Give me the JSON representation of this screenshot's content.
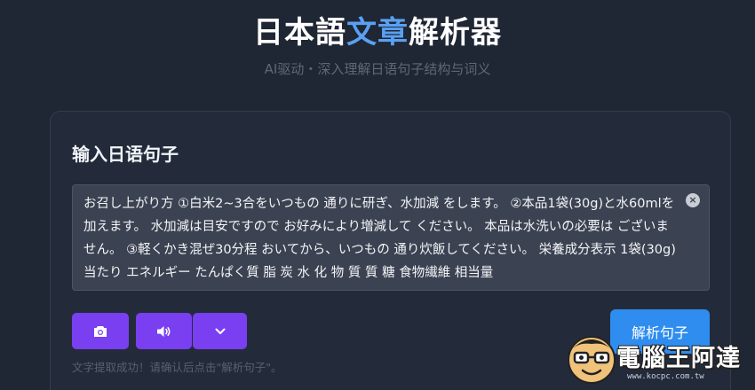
{
  "header": {
    "title_part1": "日本語",
    "title_accent": "文章",
    "title_part2": "解析器",
    "subtitle": "AI驱动・深入理解日语句子结构与词义"
  },
  "input_card": {
    "title": "输入日语句子",
    "text": "お召し上がり方 ①白米2~3合をいつもの 通りに研ぎ、水加減 をします。 ②本品1袋(30g)と水60mlを加えます。 水加減は目安ですので お好みにより増減して ください。 本品は水洗いの必要は ございません。 ③軽くかき混ぜ30分程 おいてから、いつもの 通り炊飯してください。 栄養成分表示 1袋(30g) 当たり エネルギー たんぱく質 脂 炭 水 化 物 質 質 糖 食物繊維 相当量",
    "clear_icon": "close-icon",
    "clear_symbol": "×"
  },
  "toolbar": {
    "camera_icon": "camera-icon",
    "speaker_icon": "speaker-icon",
    "dropdown_icon": "chevron-down-icon",
    "parse_label": "解析句子"
  },
  "status": {
    "message": "文字提取成功！请确认后点击\"解析句子\"。"
  },
  "watermark": {
    "text": "電腦王阿達",
    "url": "www.kocpc.com.tw"
  },
  "colors": {
    "background": "#1f2634",
    "card": "#232b3a",
    "accent_text": "#5aa0f2",
    "purple_button": "#7a3ff0",
    "blue_button": "#2f8df0"
  }
}
